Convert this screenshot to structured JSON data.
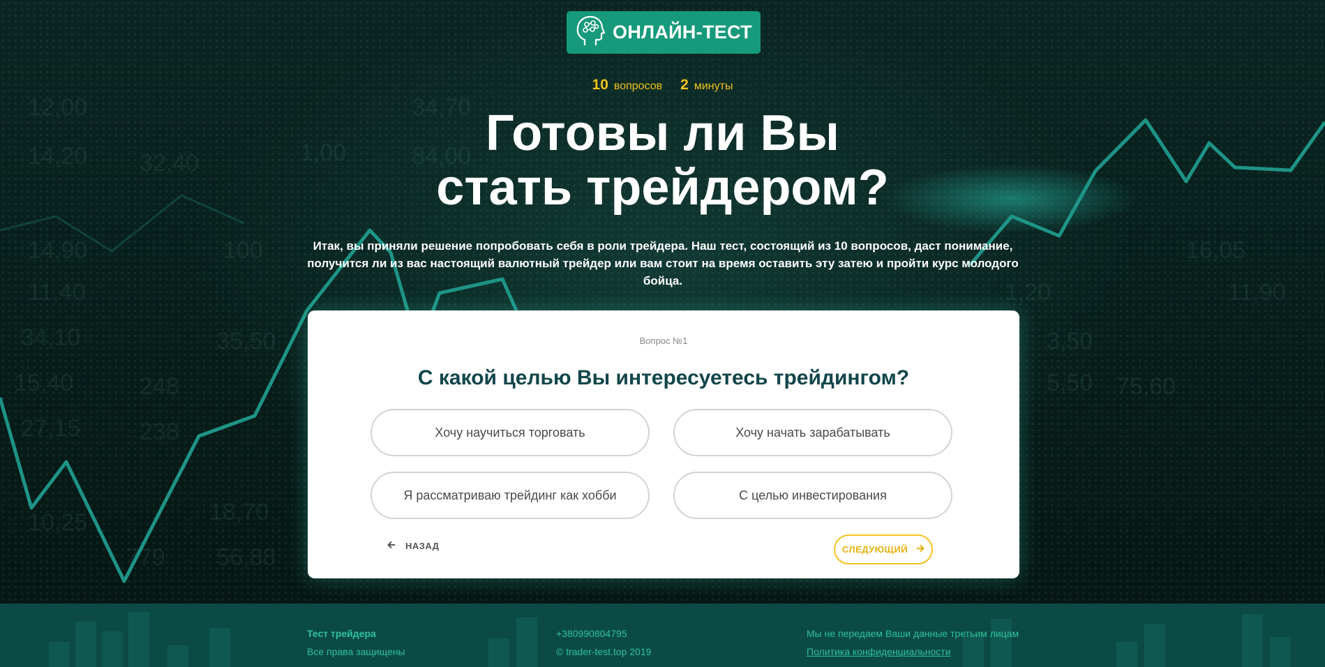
{
  "badge": {
    "label": "ОНЛАЙН-ТЕСТ",
    "icon": "brain-head-icon"
  },
  "meta": {
    "questions_count": "10",
    "questions_label": "вопросов",
    "minutes_count": "2",
    "minutes_label": "минуты"
  },
  "hero": {
    "title_line1": "Готовы ли Вы",
    "title_line2": "стать трейдером?",
    "intro": "Итак, вы приняли решение попробовать себя в роли трейдера. Наш тест, состоящий из 10 вопросов, даст понимание, получится ли из вас настоящий валютный трейдер или вам стоит на время оставить эту затею и пройти курс молодого бойца."
  },
  "question": {
    "number": "Вопрос №1",
    "title": "С какой целью Вы интересуетесь трейдингом?",
    "answers": [
      "Хочу научиться торговать",
      "Хочу начать зарабатывать",
      "Я рассматриваю трейдинг как хобби",
      "С целью инвестирования"
    ],
    "back_label": "НАЗАД",
    "next_label": "СЛЕДУЮЩИЙ"
  },
  "footer": {
    "brand": "Тест трейдера",
    "rights": "Все права защищены",
    "phone": "+380990804795",
    "copyright": "© trader-test.top 2019",
    "privacy_note": "Мы не передаем Ваши данные третьим лицам",
    "privacy_link": "Политика конфиденциальности"
  },
  "colors": {
    "accent_green": "#169a7b",
    "accent_yellow": "#f2c21b",
    "question_text": "#12464b",
    "footer_bg": "#0b4a45"
  }
}
